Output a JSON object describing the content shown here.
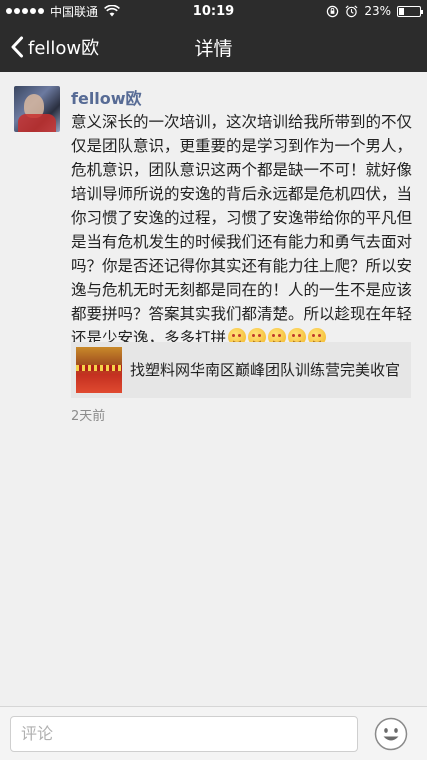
{
  "status_bar": {
    "carrier": "中国联通",
    "time": "10:19",
    "battery_percent_label": "23%",
    "battery_level": 0.23
  },
  "nav": {
    "back_label": "fellow欧",
    "title": "详情"
  },
  "post": {
    "username": "fellow欧",
    "text": "意义深长的一次培训，这次培训给我所带到的不仅仅是团队意识，更重要的是学习到作为一个男人，危机意识，团队意识这两个都是缺一不可！就好像培训导师所说的安逸的背后永远都是危机四伏，当你习惯了安逸的过程，习惯了安逸带给你的平凡但是当有危机发生的时候我们还有能力和勇气去面对吗？你是否还记得你其实还有能力往上爬？所以安逸与危机无时无刻都是同在的！人的一生不是应该都要拼吗？答案其实我们都清楚。所以趁现在年轻还是少安逸，多多打拼",
    "emoji_count": 5,
    "link_title": "找塑料网华南区巅峰团队训练营完美收官",
    "timestamp": "2天前"
  },
  "comment": {
    "placeholder": "评论"
  },
  "colors": {
    "bar_bg": "#2c2c2c",
    "username": "#576b95",
    "page_bg": "#f0f0f0"
  }
}
